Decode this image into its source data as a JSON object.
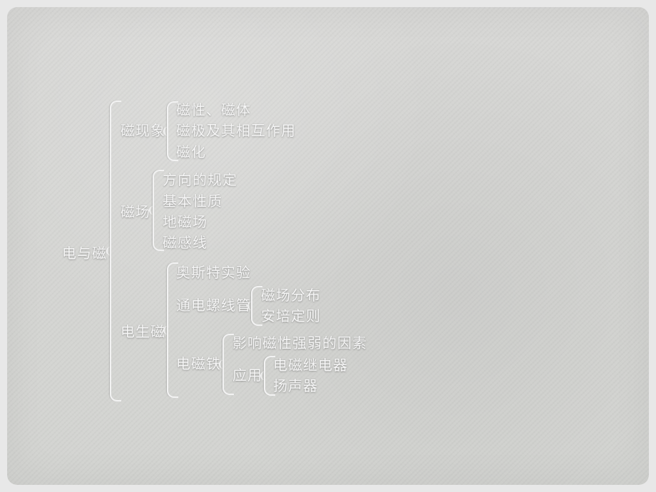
{
  "root": {
    "label": "电与磁"
  },
  "topics": [
    {
      "label": "磁现象",
      "children": [
        {
          "label": "磁性、磁体"
        },
        {
          "label": "磁极及其相互作用"
        },
        {
          "label": "磁化"
        }
      ]
    },
    {
      "label": "磁场",
      "children": [
        {
          "label": "方向的规定"
        },
        {
          "label": "基本性质"
        },
        {
          "label": "地磁场"
        },
        {
          "label": "磁感线"
        }
      ]
    },
    {
      "label": "电生磁",
      "children": [
        {
          "label": "奥斯特实验"
        },
        {
          "label": "通电螺线管",
          "children": [
            {
              "label": "磁场分布"
            },
            {
              "label": "安培定则"
            }
          ]
        },
        {
          "label": "电磁铁",
          "children": [
            {
              "label": "影响磁性强弱的因素"
            },
            {
              "label": "应用",
              "children": [
                {
                  "label": "电磁继电器"
                },
                {
                  "label": "扬声器"
                }
              ]
            }
          ]
        }
      ]
    }
  ]
}
